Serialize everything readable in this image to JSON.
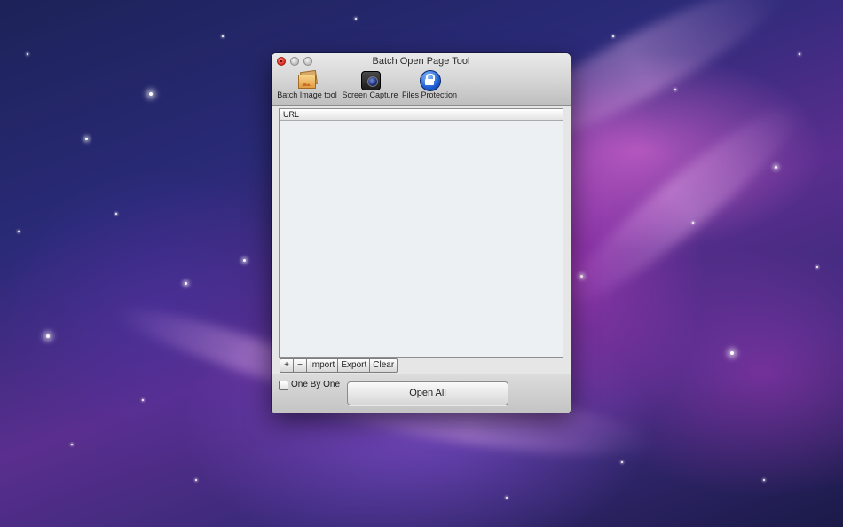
{
  "window": {
    "title": "Batch Open Page Tool"
  },
  "toolbar": {
    "items": [
      {
        "label": "Batch Image tool",
        "icon": "image-stack-icon"
      },
      {
        "label": "Screen Capture",
        "icon": "camera-icon"
      },
      {
        "label": "Files Protection",
        "icon": "lock-icon"
      }
    ]
  },
  "table": {
    "header": "URL",
    "rows": []
  },
  "actions": {
    "add": "+",
    "remove": "−",
    "import": "Import",
    "export": "Export",
    "clear": "Clear"
  },
  "options": {
    "one_by_one": {
      "label": "One By One",
      "checked": false
    }
  },
  "primary": {
    "open_all": "Open All"
  }
}
